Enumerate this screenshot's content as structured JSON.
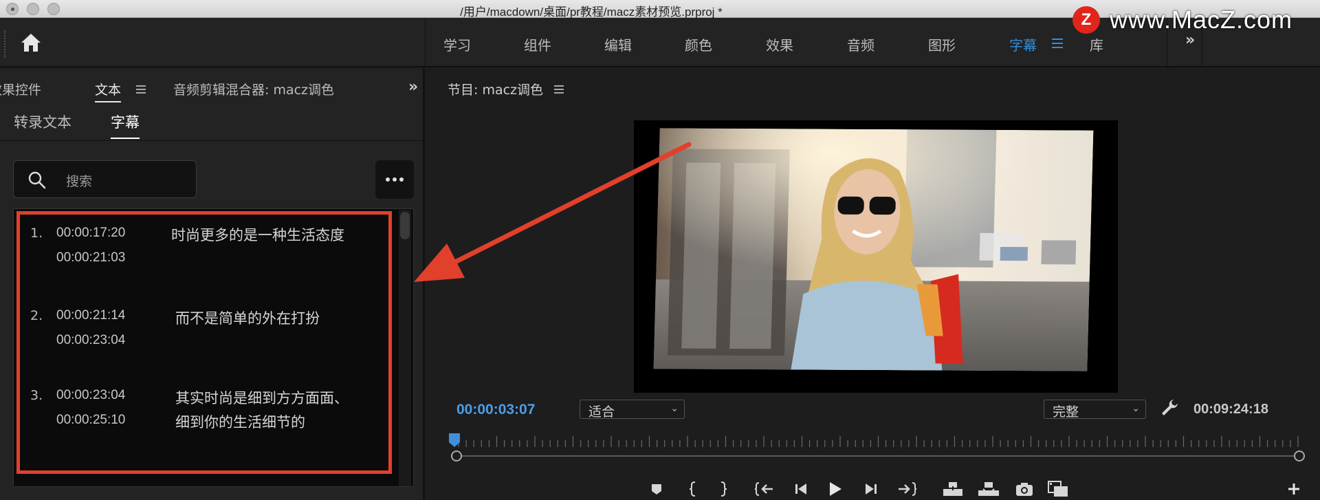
{
  "window": {
    "title": "/用户/macdown/桌面/pr教程/macz素材预览.prproj *"
  },
  "watermark": {
    "logo_letter": "Z",
    "text": "www.MacZ.com"
  },
  "workspaces": {
    "tabs": [
      "学习",
      "组件",
      "编辑",
      "颜色",
      "效果",
      "音频",
      "图形",
      "字幕",
      "库"
    ],
    "active": "字幕",
    "overflow": "»"
  },
  "left_panel": {
    "tabs": [
      "效果控件",
      "文本",
      "音频剪辑混合器: macz调色"
    ],
    "active_tab": "文本",
    "overflow": "»",
    "subtabs": [
      "转录文本",
      "字幕"
    ],
    "active_subtab": "字幕",
    "search_placeholder": "搜索",
    "captions": [
      {
        "num": "1.",
        "start": "00:00:17:20",
        "end": "00:00:21:03",
        "text": [
          "时尚更多的是一种生活态度"
        ]
      },
      {
        "num": "2.",
        "start": "00:00:21:14",
        "end": "00:00:23:04",
        "text": [
          "而不是简单的外在打扮"
        ]
      },
      {
        "num": "3.",
        "start": "00:00:23:04",
        "end": "00:00:25:10",
        "text": [
          "其实时尚是细到方方面面、",
          "细到你的生活细节的"
        ]
      }
    ]
  },
  "program_monitor": {
    "title": "节目: macz调色",
    "current_timecode": "00:00:03:07",
    "zoom_option": "适合",
    "quality_option": "完整",
    "duration_timecode": "00:09:24:18"
  },
  "colors": {
    "accent_blue": "#2f8fdd",
    "highlight_red": "#e1402b"
  },
  "icons": {
    "transport": [
      "marker-icon",
      "mark-in-icon",
      "mark-out-icon",
      "go-to-in-icon",
      "step-back-icon",
      "play-icon",
      "step-forward-icon",
      "go-to-out-icon",
      "lift-icon",
      "extract-icon",
      "export-frame-icon",
      "comparison-view-icon",
      "add-button-icon"
    ]
  }
}
